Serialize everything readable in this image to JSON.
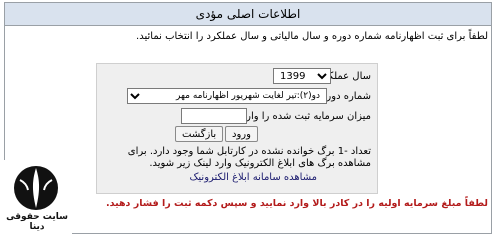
{
  "panel": {
    "title": "اطلاعات اصلی مؤدی"
  },
  "intro": {
    "text": "لطفاً برای ثبت اظهارنامه شماره دوره و سال مالیاتی و سال عملکرد را انتخاب نمائید."
  },
  "form": {
    "year_label": "سال عملکرد:",
    "year_value": "1399",
    "period_label": "شماره دوره:",
    "period_value": "دو(۲):تیر لغایت شهریور اظهارنامه مهر",
    "capital_label": "میزان سرمایه ثبت شده را وارد نمایید.",
    "capital_value": "",
    "enter_button": "ورود",
    "back_button": "بازگشت",
    "count_text": "تعداد -1 برگ خوانده نشده در کارتابل شما وجود دارد. برای مشاهده برگ های ابلاغ الکترونیک وارد لینک زیر شوید.",
    "link_text": "مشاهده سامانه ابلاغ الکترونیک"
  },
  "warning": {
    "text": "لطفاً مبلغ سرمایه اولیه را در کادر بالا وارد نمایید و سپس دکمه ثبت را فشار دهید."
  },
  "watermark": {
    "label": "سایت حقوقی دینا"
  },
  "colors": {
    "header_bg": "#d9e2ee",
    "form_bg": "#efefef",
    "warning": "#b31b1b",
    "link": "#1a1a6e"
  }
}
